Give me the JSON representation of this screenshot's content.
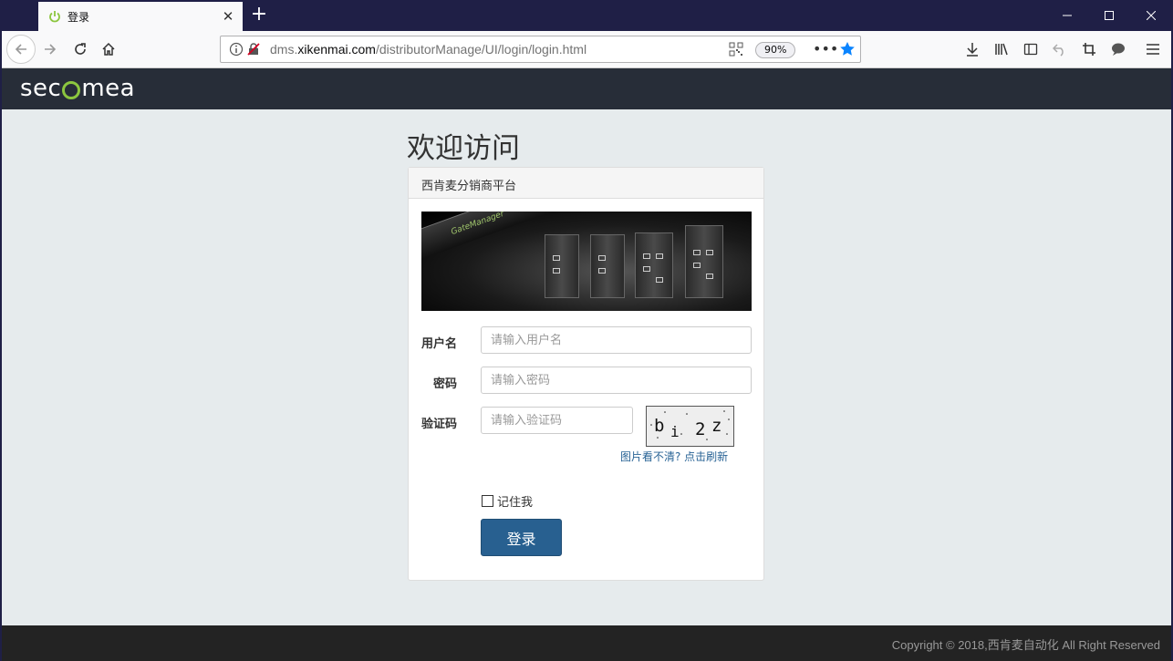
{
  "browser": {
    "tab_title": "登录",
    "url_prefix": "dms.",
    "url_host": "xikenmai.com",
    "url_path": "/distributorManage/UI/login/login.html",
    "zoom": "90%",
    "accent_color": "#0a84ff"
  },
  "header": {
    "logo_left": "sec",
    "logo_right": "mea",
    "brand_color": "#8cc63f",
    "bg_color": "#272d38"
  },
  "main": {
    "welcome": "欢迎访问",
    "panel_title": "西肯麦分销商平台",
    "banner_device_label": "GateManager",
    "username_label": "用户名",
    "username_placeholder": "请输入用户名",
    "password_label": "密码",
    "password_placeholder": "请输入密码",
    "captcha_label": "验证码",
    "captcha_placeholder": "请输入验证码",
    "captcha_chars": [
      "b",
      "i",
      "2",
      "z"
    ],
    "refresh_link": "图片看不清? 点击刷新",
    "remember_label": "记住我",
    "login_button": "登录",
    "button_color": "#286090"
  },
  "footer": {
    "copyright": "Copyright © 2018,西肯麦自动化 All Right Reserved"
  }
}
